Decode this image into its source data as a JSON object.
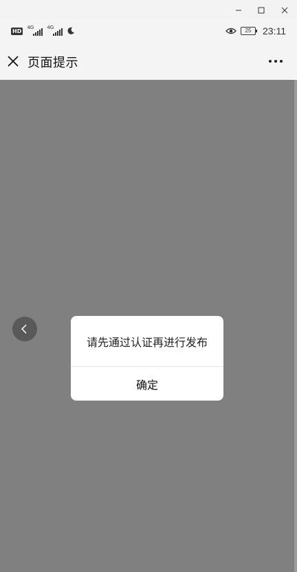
{
  "window": {
    "minimize_icon": "minimize-icon",
    "maximize_icon": "maximize-icon",
    "close_icon": "close-icon"
  },
  "status_bar": {
    "hd_label": "HD",
    "net1": "4G",
    "net2": "4G",
    "battery": "25",
    "time": "23:11",
    "icons": [
      "moon-icon",
      "eye-icon",
      "battery-icon"
    ]
  },
  "header": {
    "title": "页面提示",
    "close_icon": "close-icon",
    "more_icon": "more-icon"
  },
  "modal": {
    "message": "请先通过认证再进行发布",
    "confirm_label": "确定"
  },
  "back_button": {
    "icon": "chevron-left-icon"
  }
}
